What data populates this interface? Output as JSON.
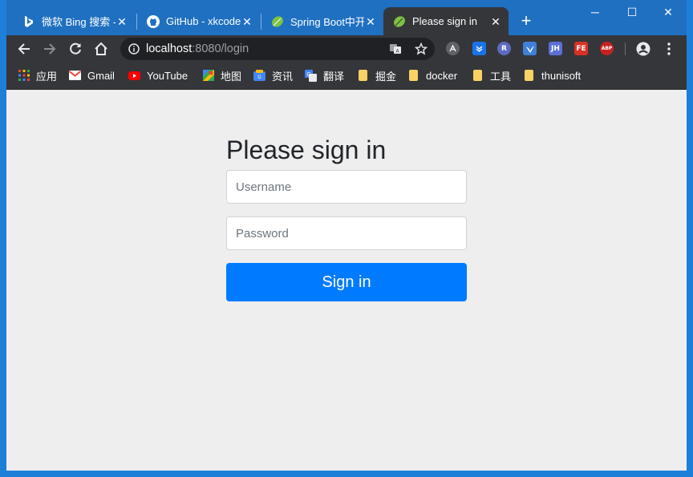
{
  "tabs": [
    {
      "title": "微软 Bing 搜索 -",
      "icon": "bing-icon"
    },
    {
      "title": "GitHub - xkcode",
      "icon": "github-icon"
    },
    {
      "title": "Spring Boot中开",
      "icon": "spring-leaf-icon"
    },
    {
      "title": "Please sign in",
      "icon": "spring-leaf-icon",
      "active": true
    }
  ],
  "address": {
    "host": "localhost",
    "rest": ":8080/login"
  },
  "extensions": [
    "R",
    "JH",
    "FE",
    "ABP"
  ],
  "bookmarks": [
    {
      "label": "应用",
      "icon": "apps-grid-icon"
    },
    {
      "label": "Gmail",
      "icon": "gmail-icon"
    },
    {
      "label": "YouTube",
      "icon": "youtube-icon"
    },
    {
      "label": "地图",
      "icon": "maps-icon"
    },
    {
      "label": "资讯",
      "icon": "news-icon"
    },
    {
      "label": "翻译",
      "icon": "translate-icon"
    },
    {
      "label": "掘金",
      "icon": "folder-icon"
    },
    {
      "label": "docker",
      "icon": "folder-icon"
    },
    {
      "label": "工具",
      "icon": "folder-icon"
    },
    {
      "label": "thunisoft",
      "icon": "folder-icon"
    }
  ],
  "form": {
    "heading": "Please sign in",
    "username_placeholder": "Username",
    "password_placeholder": "Password",
    "submit_label": "Sign in"
  },
  "colors": {
    "accent": "#007bff",
    "titlebar": "#1f70c1",
    "toolbar": "#35363a"
  }
}
